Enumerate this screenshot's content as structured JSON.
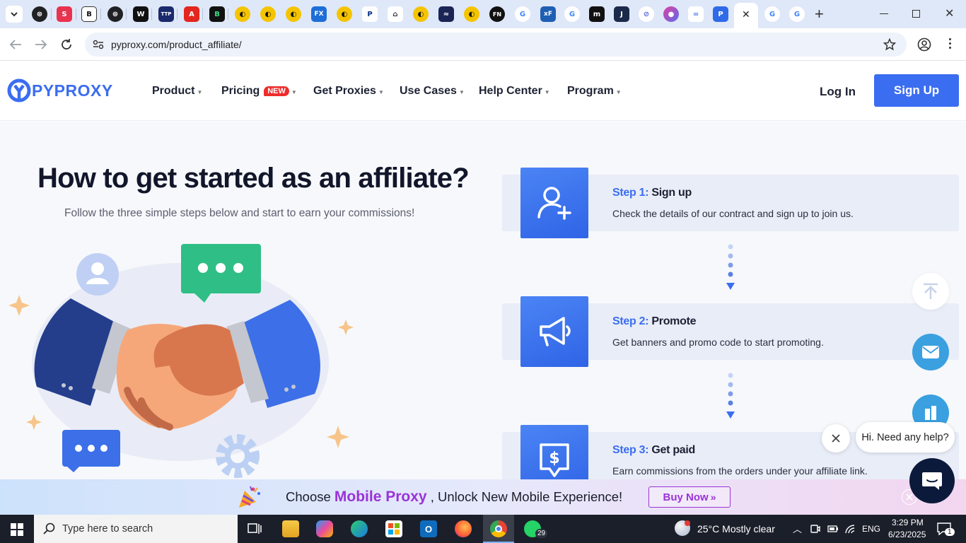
{
  "browser": {
    "url": "pyproxy.com/product_affiliate/",
    "tab_close": "✕",
    "new_tab": "+"
  },
  "site": {
    "logo_text": "PYPROXY",
    "nav": [
      {
        "label": "Product"
      },
      {
        "label": "Pricing",
        "badge": "NEW"
      },
      {
        "label": "Get Proxies"
      },
      {
        "label": "Use Cases"
      },
      {
        "label": "Help Center"
      },
      {
        "label": "Program"
      }
    ],
    "login": "Log In",
    "signup": "Sign Up"
  },
  "main": {
    "heading": "How to get started as an affiliate?",
    "subheading": "Follow the three simple steps below and start to earn your commissions!",
    "steps": [
      {
        "num": "Step 1:",
        "title": "Sign up",
        "desc": "Check the details of our contract and sign up to join us."
      },
      {
        "num": "Step 2:",
        "title": "Promote",
        "desc": "Get banners and promo code to start promoting."
      },
      {
        "num": "Step 3:",
        "title": "Get paid",
        "desc": "Earn commissions from the orders under your affiliate link."
      }
    ]
  },
  "chat": {
    "bubble": "Hi. Need any help?"
  },
  "promo": {
    "prefix": "Choose ",
    "highlight": "Mobile Proxy",
    "suffix": " , Unlock New Mobile Experience!",
    "button": "Buy Now"
  },
  "taskbar": {
    "search_placeholder": "Type here to search",
    "whatsapp_badge": "29",
    "weather": "25°C  Mostly clear",
    "lang": "ENG",
    "time": "3:29 PM",
    "date": "6/23/2025",
    "notif_count": "1"
  },
  "colors": {
    "brand_blue": "#3b6df0",
    "promo_purple": "#9a33d8",
    "badge_red": "#ee2c2c"
  }
}
